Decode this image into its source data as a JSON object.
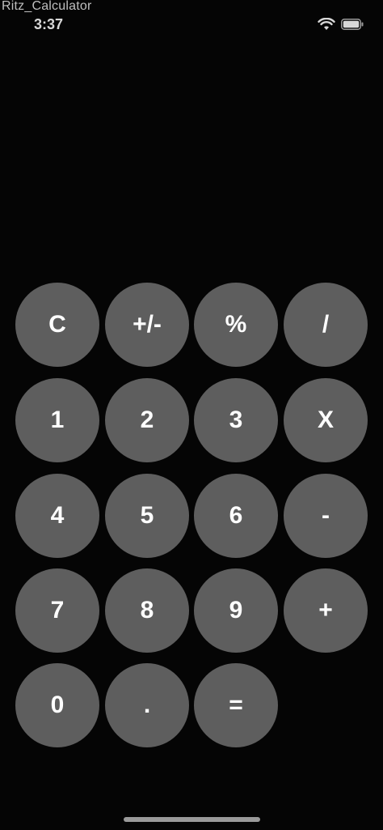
{
  "status_bar": {
    "app_name": "Ritz_Calculator",
    "time": "3:37",
    "wifi_icon": "wifi-icon",
    "battery_icon": "battery-icon"
  },
  "display": {
    "value": ""
  },
  "keypad": {
    "keys": [
      {
        "id": "clear",
        "label": "C"
      },
      {
        "id": "sign",
        "label": "+/-"
      },
      {
        "id": "percent",
        "label": "%"
      },
      {
        "id": "divide",
        "label": "/"
      },
      {
        "id": "1",
        "label": "1"
      },
      {
        "id": "2",
        "label": "2"
      },
      {
        "id": "3",
        "label": "3"
      },
      {
        "id": "multiply",
        "label": "X"
      },
      {
        "id": "4",
        "label": "4"
      },
      {
        "id": "5",
        "label": "5"
      },
      {
        "id": "6",
        "label": "6"
      },
      {
        "id": "subtract",
        "label": "-"
      },
      {
        "id": "7",
        "label": "7"
      },
      {
        "id": "8",
        "label": "8"
      },
      {
        "id": "9",
        "label": "9"
      },
      {
        "id": "add",
        "label": "+"
      },
      {
        "id": "0",
        "label": "0"
      },
      {
        "id": "decimal",
        "label": "."
      },
      {
        "id": "equals",
        "label": "="
      }
    ]
  },
  "colors": {
    "background": "#050505",
    "key": "#5e5e5e",
    "key_text": "#ffffff"
  }
}
